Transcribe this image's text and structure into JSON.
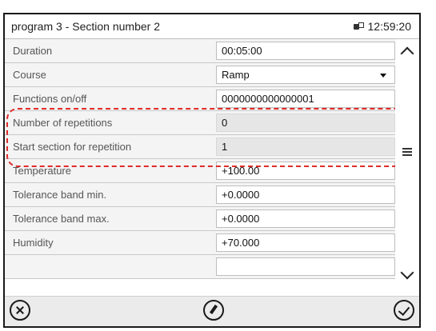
{
  "window": {
    "title": "program 3 - Section number 2",
    "time": "12:59:20"
  },
  "rows": [
    {
      "label": "Duration",
      "value": "00:05:00"
    },
    {
      "label": "Course",
      "value": "Ramp"
    },
    {
      "label": "Functions on/off",
      "value": "0000000000000001"
    },
    {
      "label": "Number of repetitions",
      "value": "0"
    },
    {
      "label": "Start section for repetition",
      "value": "1"
    },
    {
      "label": "Temperature",
      "value": "+100.00"
    },
    {
      "label": "Tolerance band min.",
      "value": "+0.0000"
    },
    {
      "label": "Tolerance band max.",
      "value": "+0.0000"
    },
    {
      "label": "Humidity",
      "value": "+70.000"
    },
    {
      "label": "",
      "value": ""
    }
  ],
  "icons": {
    "network": "network-icon",
    "cancel": "cancel-icon",
    "edit": "edit-icon",
    "confirm": "confirm-icon",
    "scroll_up": "chevron-up-icon",
    "scroll_handle": "menu-icon",
    "scroll_down": "chevron-down-icon"
  },
  "colors": {
    "highlight": "#e02a2a",
    "readonly_field": "#e6e6e6"
  }
}
